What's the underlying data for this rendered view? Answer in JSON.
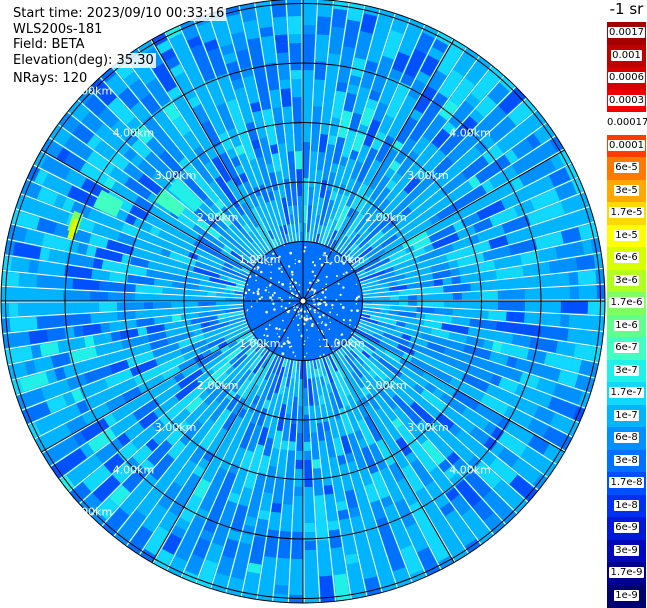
{
  "info": {
    "start_time": "Start time: 2023/09/10 00:33:16",
    "instrument": "WLS200s-181",
    "field": "Field: BETA",
    "elevation": "Elevation(deg): 35.30",
    "nrays": "NRays: 120"
  },
  "legend": {
    "title": "-1 sr",
    "entries": [
      {
        "label": "0.0017",
        "color": "#a50000"
      },
      {
        "label": "0.001",
        "color": "#bd0000"
      },
      {
        "label": "0.0006",
        "color": "#d50000"
      },
      {
        "label": "0.0003",
        "color": "#f00000"
      },
      {
        "label": "0.00017",
        "color": "#ffffff"
      },
      {
        "label": "0.0001",
        "color": "#ff3c00"
      },
      {
        "label": "6e-5",
        "color": "#ff7800"
      },
      {
        "label": "3e-5",
        "color": "#ffa800"
      },
      {
        "label": "1.7e-5",
        "color": "#ffd800"
      },
      {
        "label": "1e-5",
        "color": "#ffff00"
      },
      {
        "label": "6e-6",
        "color": "#d8ff00"
      },
      {
        "label": "3e-6",
        "color": "#b0ff20"
      },
      {
        "label": "1.7e-6",
        "color": "#80ff60"
      },
      {
        "label": "1e-6",
        "color": "#60ff90"
      },
      {
        "label": "6e-7",
        "color": "#40ffc0"
      },
      {
        "label": "3e-7",
        "color": "#20f0e8"
      },
      {
        "label": "1.7e-7",
        "color": "#10d8ff"
      },
      {
        "label": "1e-7",
        "color": "#00b4ff"
      },
      {
        "label": "6e-8",
        "color": "#0090ff"
      },
      {
        "label": "3e-8",
        "color": "#0070ff"
      },
      {
        "label": "1.7e-8",
        "color": "#0050ff"
      },
      {
        "label": "1e-8",
        "color": "#0030f0"
      },
      {
        "label": "6e-9",
        "color": "#0018d8"
      },
      {
        "label": "3e-9",
        "color": "#0008b8"
      },
      {
        "label": "1.7e-9",
        "color": "#000090"
      },
      {
        "label": "1e-9",
        "color": "#000070"
      }
    ]
  },
  "plot": {
    "range_labels": [
      "1.00km",
      "2.00km",
      "3.00km",
      "4.00km",
      "5.00km"
    ],
    "palette": [
      "#0050ff",
      "#0070ff",
      "#0090ff",
      "#00b4ff",
      "#10d8ff",
      "#20f0e8",
      "#40ffc0",
      "#80ff60",
      "#d8ff00"
    ]
  }
}
